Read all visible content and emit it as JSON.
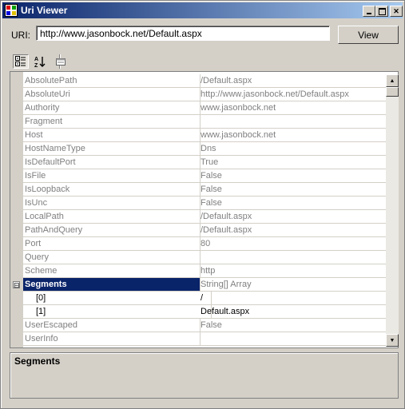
{
  "window": {
    "title": "Uri Viewer",
    "icon": "app-window-icon"
  },
  "title_buttons": [
    "minimize-icon",
    "maximize-icon",
    "close-icon"
  ],
  "uri": {
    "label": "URI:",
    "value": "http://www.jasonbock.net/Default.aspx",
    "view_button": "View"
  },
  "toolbar": {
    "tools": [
      "categorized-icon",
      "alphabetical-sort-icon",
      "property-pages-icon"
    ]
  },
  "grid": {
    "rows": [
      {
        "name": "AbsolutePath",
        "value": "/Default.aspx"
      },
      {
        "name": "AbsoluteUri",
        "value": "http://www.jasonbock.net/Default.aspx"
      },
      {
        "name": "Authority",
        "value": "www.jasonbock.net"
      },
      {
        "name": "Fragment",
        "value": ""
      },
      {
        "name": "Host",
        "value": "www.jasonbock.net"
      },
      {
        "name": "HostNameType",
        "value": "Dns"
      },
      {
        "name": "IsDefaultPort",
        "value": "True"
      },
      {
        "name": "IsFile",
        "value": "False"
      },
      {
        "name": "IsLoopback",
        "value": "False"
      },
      {
        "name": "IsUnc",
        "value": "False"
      },
      {
        "name": "LocalPath",
        "value": "/Default.aspx"
      },
      {
        "name": "PathAndQuery",
        "value": "/Default.aspx"
      },
      {
        "name": "Port",
        "value": "80"
      },
      {
        "name": "Query",
        "value": ""
      },
      {
        "name": "Scheme",
        "value": "http"
      },
      {
        "name": "Segments",
        "value": "String[] Array",
        "selected": true,
        "expanded": true,
        "expander": "⊟"
      },
      {
        "name": "[0]",
        "value": "/",
        "child": true
      },
      {
        "name": "[1]",
        "value": "Default.aspx",
        "child": true
      },
      {
        "name": "UserEscaped",
        "value": "False"
      },
      {
        "name": "UserInfo",
        "value": ""
      }
    ]
  },
  "help": {
    "title": "Segments"
  }
}
